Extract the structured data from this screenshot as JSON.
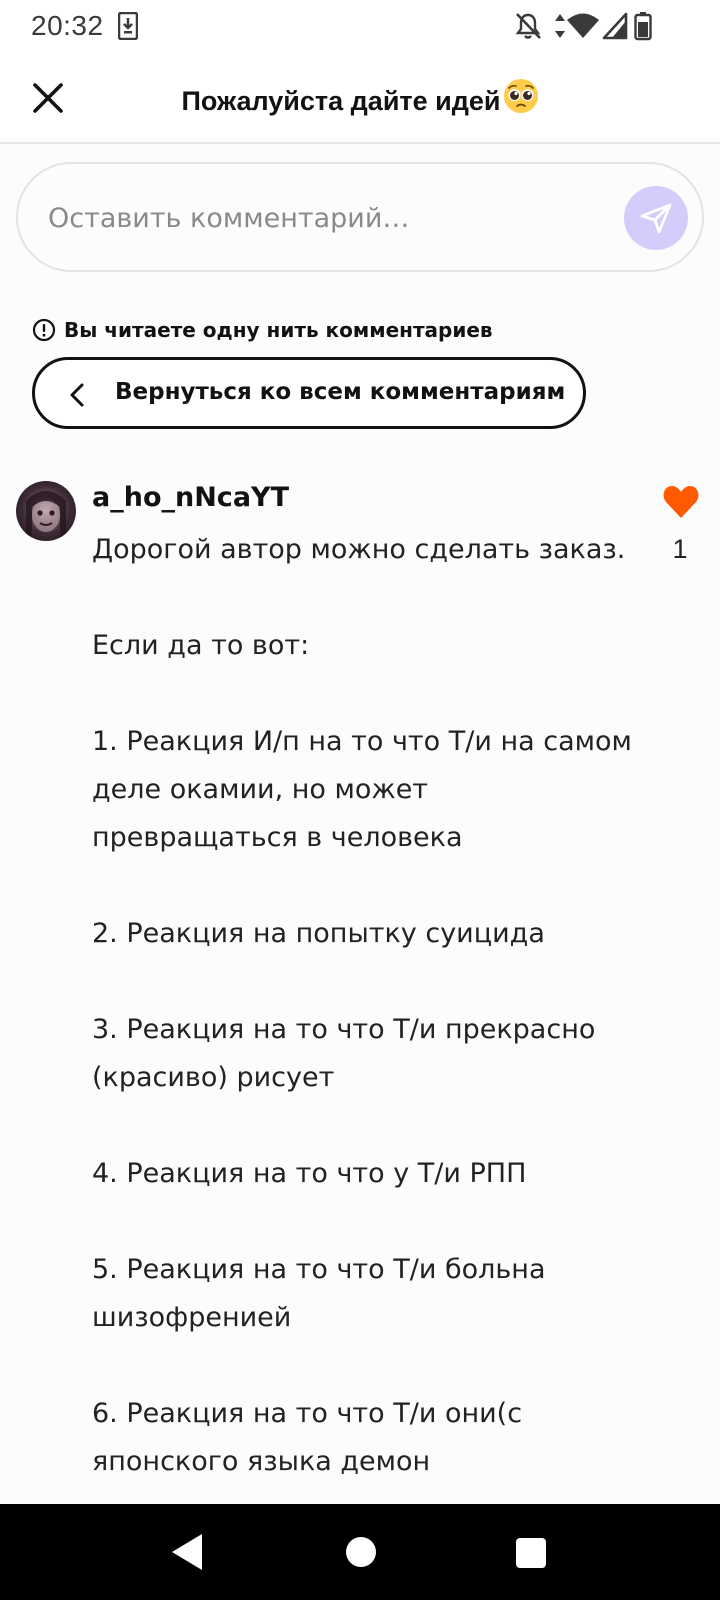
{
  "status_bar": {
    "time": "20:32",
    "icons": [
      "download-icon",
      "notifications-off-icon",
      "data-arrows-icon",
      "wifi-icon",
      "signal-icon",
      "battery-icon"
    ]
  },
  "header": {
    "title": "Пожалуйста дайте идей",
    "title_emoji": "pleading-face-emoji",
    "close_icon": "close-icon"
  },
  "comment_input": {
    "placeholder": "Оставить комментарий…",
    "value": "",
    "send_icon": "send-icon"
  },
  "thread": {
    "notice": "Вы читаете одну нить комментариев",
    "back_label": "Вернуться ко всем комментариям"
  },
  "comment": {
    "username": "a_ho_nNcaYT",
    "like_count": "1",
    "lines": [
      "Дорогой автор можно сделать заказ.",
      "",
      "Если да то вот:",
      "",
      "1. Реакция И/п на то что Т/и на самом деле окамии, но может превращаться в человека",
      "",
      "2. Реакция на попытку суицида",
      "",
      "3. Реакция на то что Т/и прекрасно (красиво) рисует",
      "",
      "4. Реакция на то что у Т/и РПП",
      "",
      "5. Реакция на то что Т/и больна шизофренией",
      "",
      "6. Реакция на то что Т/и они(с японского языка демон"
    ]
  },
  "colors": {
    "accent_like": "#ff5a00",
    "send_button_bg": "#d4ccfa",
    "text_primary": "#121212"
  }
}
